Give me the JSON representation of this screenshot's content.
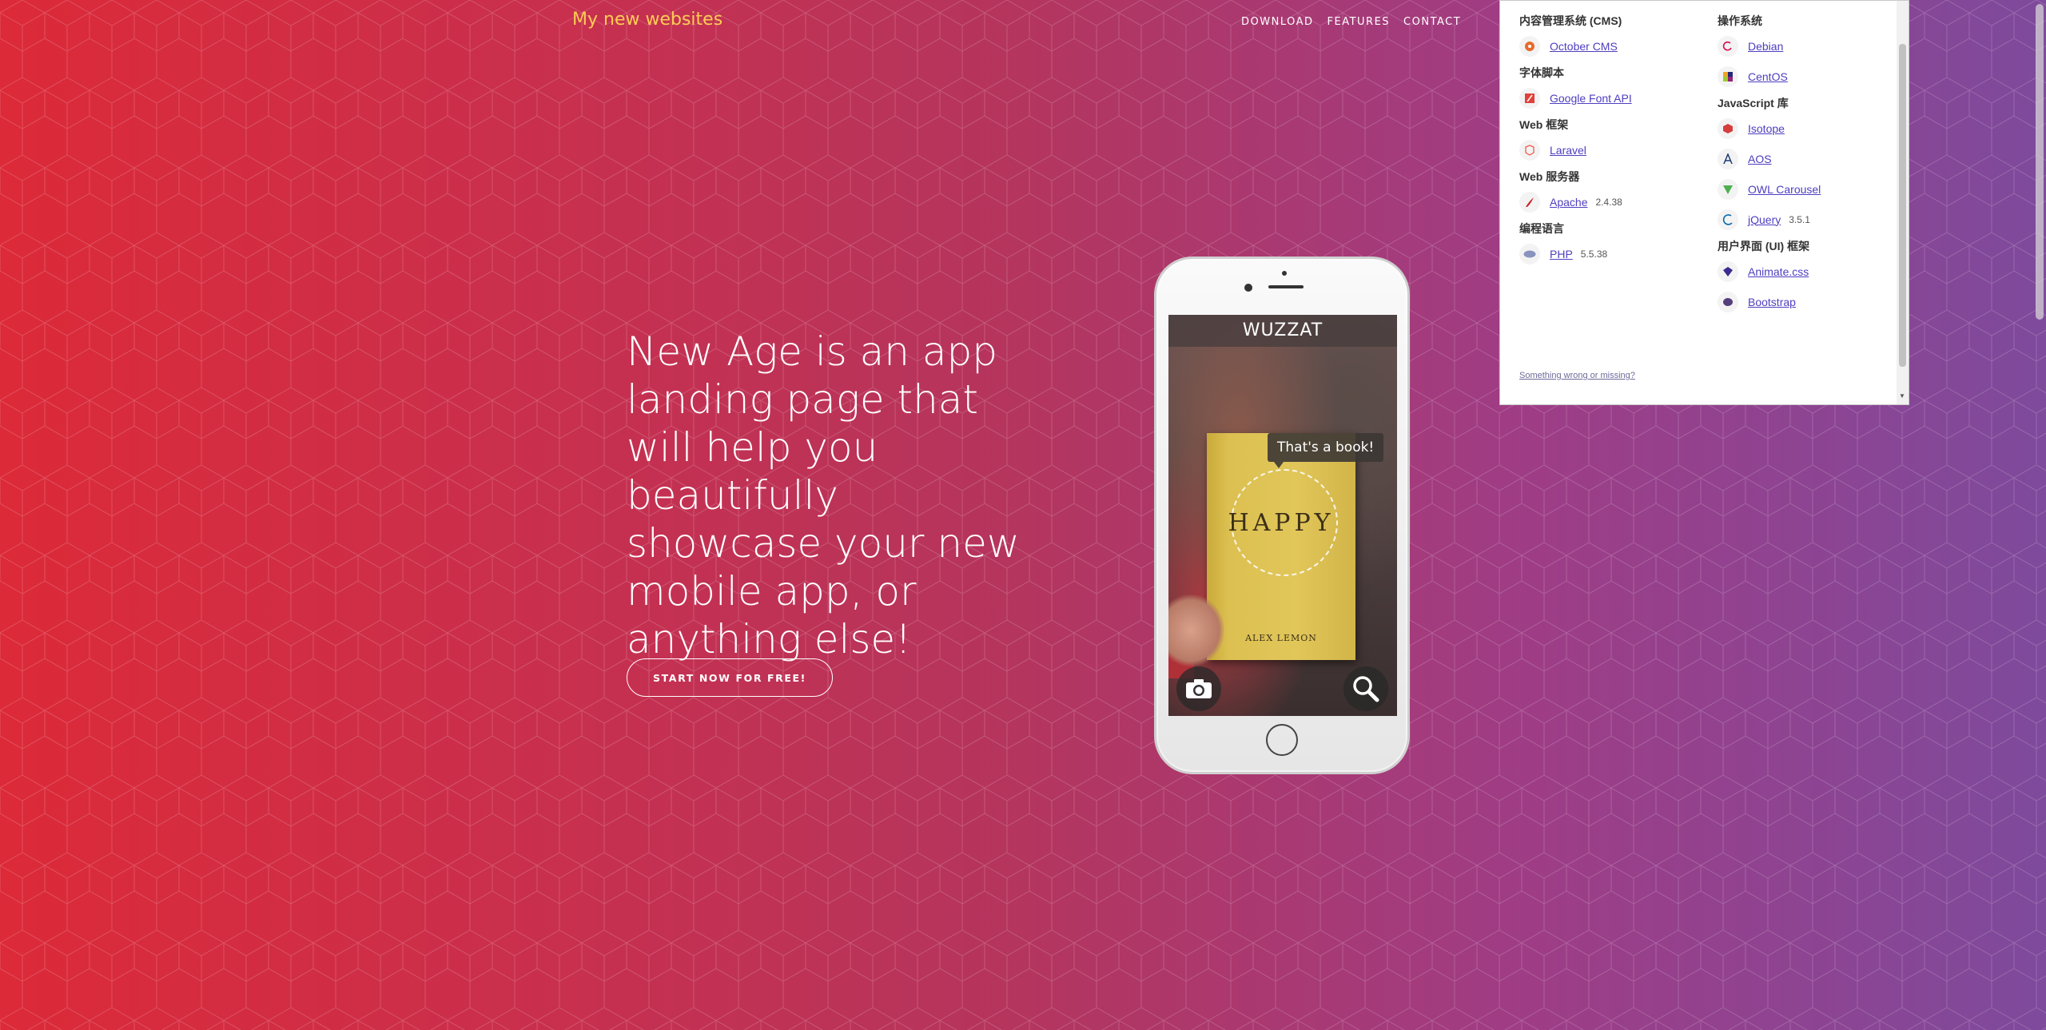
{
  "header": {
    "brand": "My new websites",
    "nav": [
      "DOWNLOAD",
      "FEATURES",
      "CONTACT"
    ]
  },
  "hero": {
    "heading": "New Age is an app landing page that will help you beautifully showcase your new mobile app, or anything else!",
    "cta": "START NOW FOR FREE!"
  },
  "phone": {
    "app_title": "WUZZAT",
    "bubble": "That's a book!",
    "book_title": "HAPPY",
    "book_author": "ALEX LEMON"
  },
  "wappalyzer": {
    "left": [
      {
        "category": "内容管理系统 (CMS)",
        "items": [
          {
            "name": "October CMS",
            "version": "",
            "icon": "october-cms-icon"
          }
        ]
      },
      {
        "category": "字体脚本",
        "items": [
          {
            "name": "Google Font API",
            "version": "",
            "icon": "google-font-api-icon"
          }
        ]
      },
      {
        "category": "Web 框架",
        "items": [
          {
            "name": "Laravel",
            "version": "",
            "icon": "laravel-icon"
          }
        ]
      },
      {
        "category": "Web 服务器",
        "items": [
          {
            "name": "Apache",
            "version": "2.4.38",
            "icon": "apache-icon"
          }
        ]
      },
      {
        "category": "编程语言",
        "items": [
          {
            "name": "PHP",
            "version": "5.5.38",
            "icon": "php-icon"
          }
        ]
      }
    ],
    "right": [
      {
        "category": "操作系统",
        "items": [
          {
            "name": "Debian",
            "version": "",
            "icon": "debian-icon"
          },
          {
            "name": "CentOS",
            "version": "",
            "icon": "centos-icon"
          }
        ]
      },
      {
        "category": "JavaScript 库",
        "items": [
          {
            "name": "Isotope",
            "version": "",
            "icon": "isotope-icon"
          },
          {
            "name": "AOS",
            "version": "",
            "icon": "aos-icon"
          },
          {
            "name": "OWL Carousel",
            "version": "",
            "icon": "owl-carousel-icon"
          },
          {
            "name": "jQuery",
            "version": "3.5.1",
            "icon": "jquery-icon"
          }
        ]
      },
      {
        "category": "用户界面 (UI) 框架",
        "items": [
          {
            "name": "Animate.css",
            "version": "",
            "icon": "animate-css-icon"
          },
          {
            "name": "Bootstrap",
            "version": "",
            "icon": "bootstrap-icon"
          }
        ]
      }
    ],
    "footer_link": "Something wrong or missing?"
  },
  "colors": {
    "brand": "#fdcc52",
    "gradient_left": "#dc2a38",
    "gradient_right": "#7e4a9c",
    "link": "#4d3fbf"
  }
}
